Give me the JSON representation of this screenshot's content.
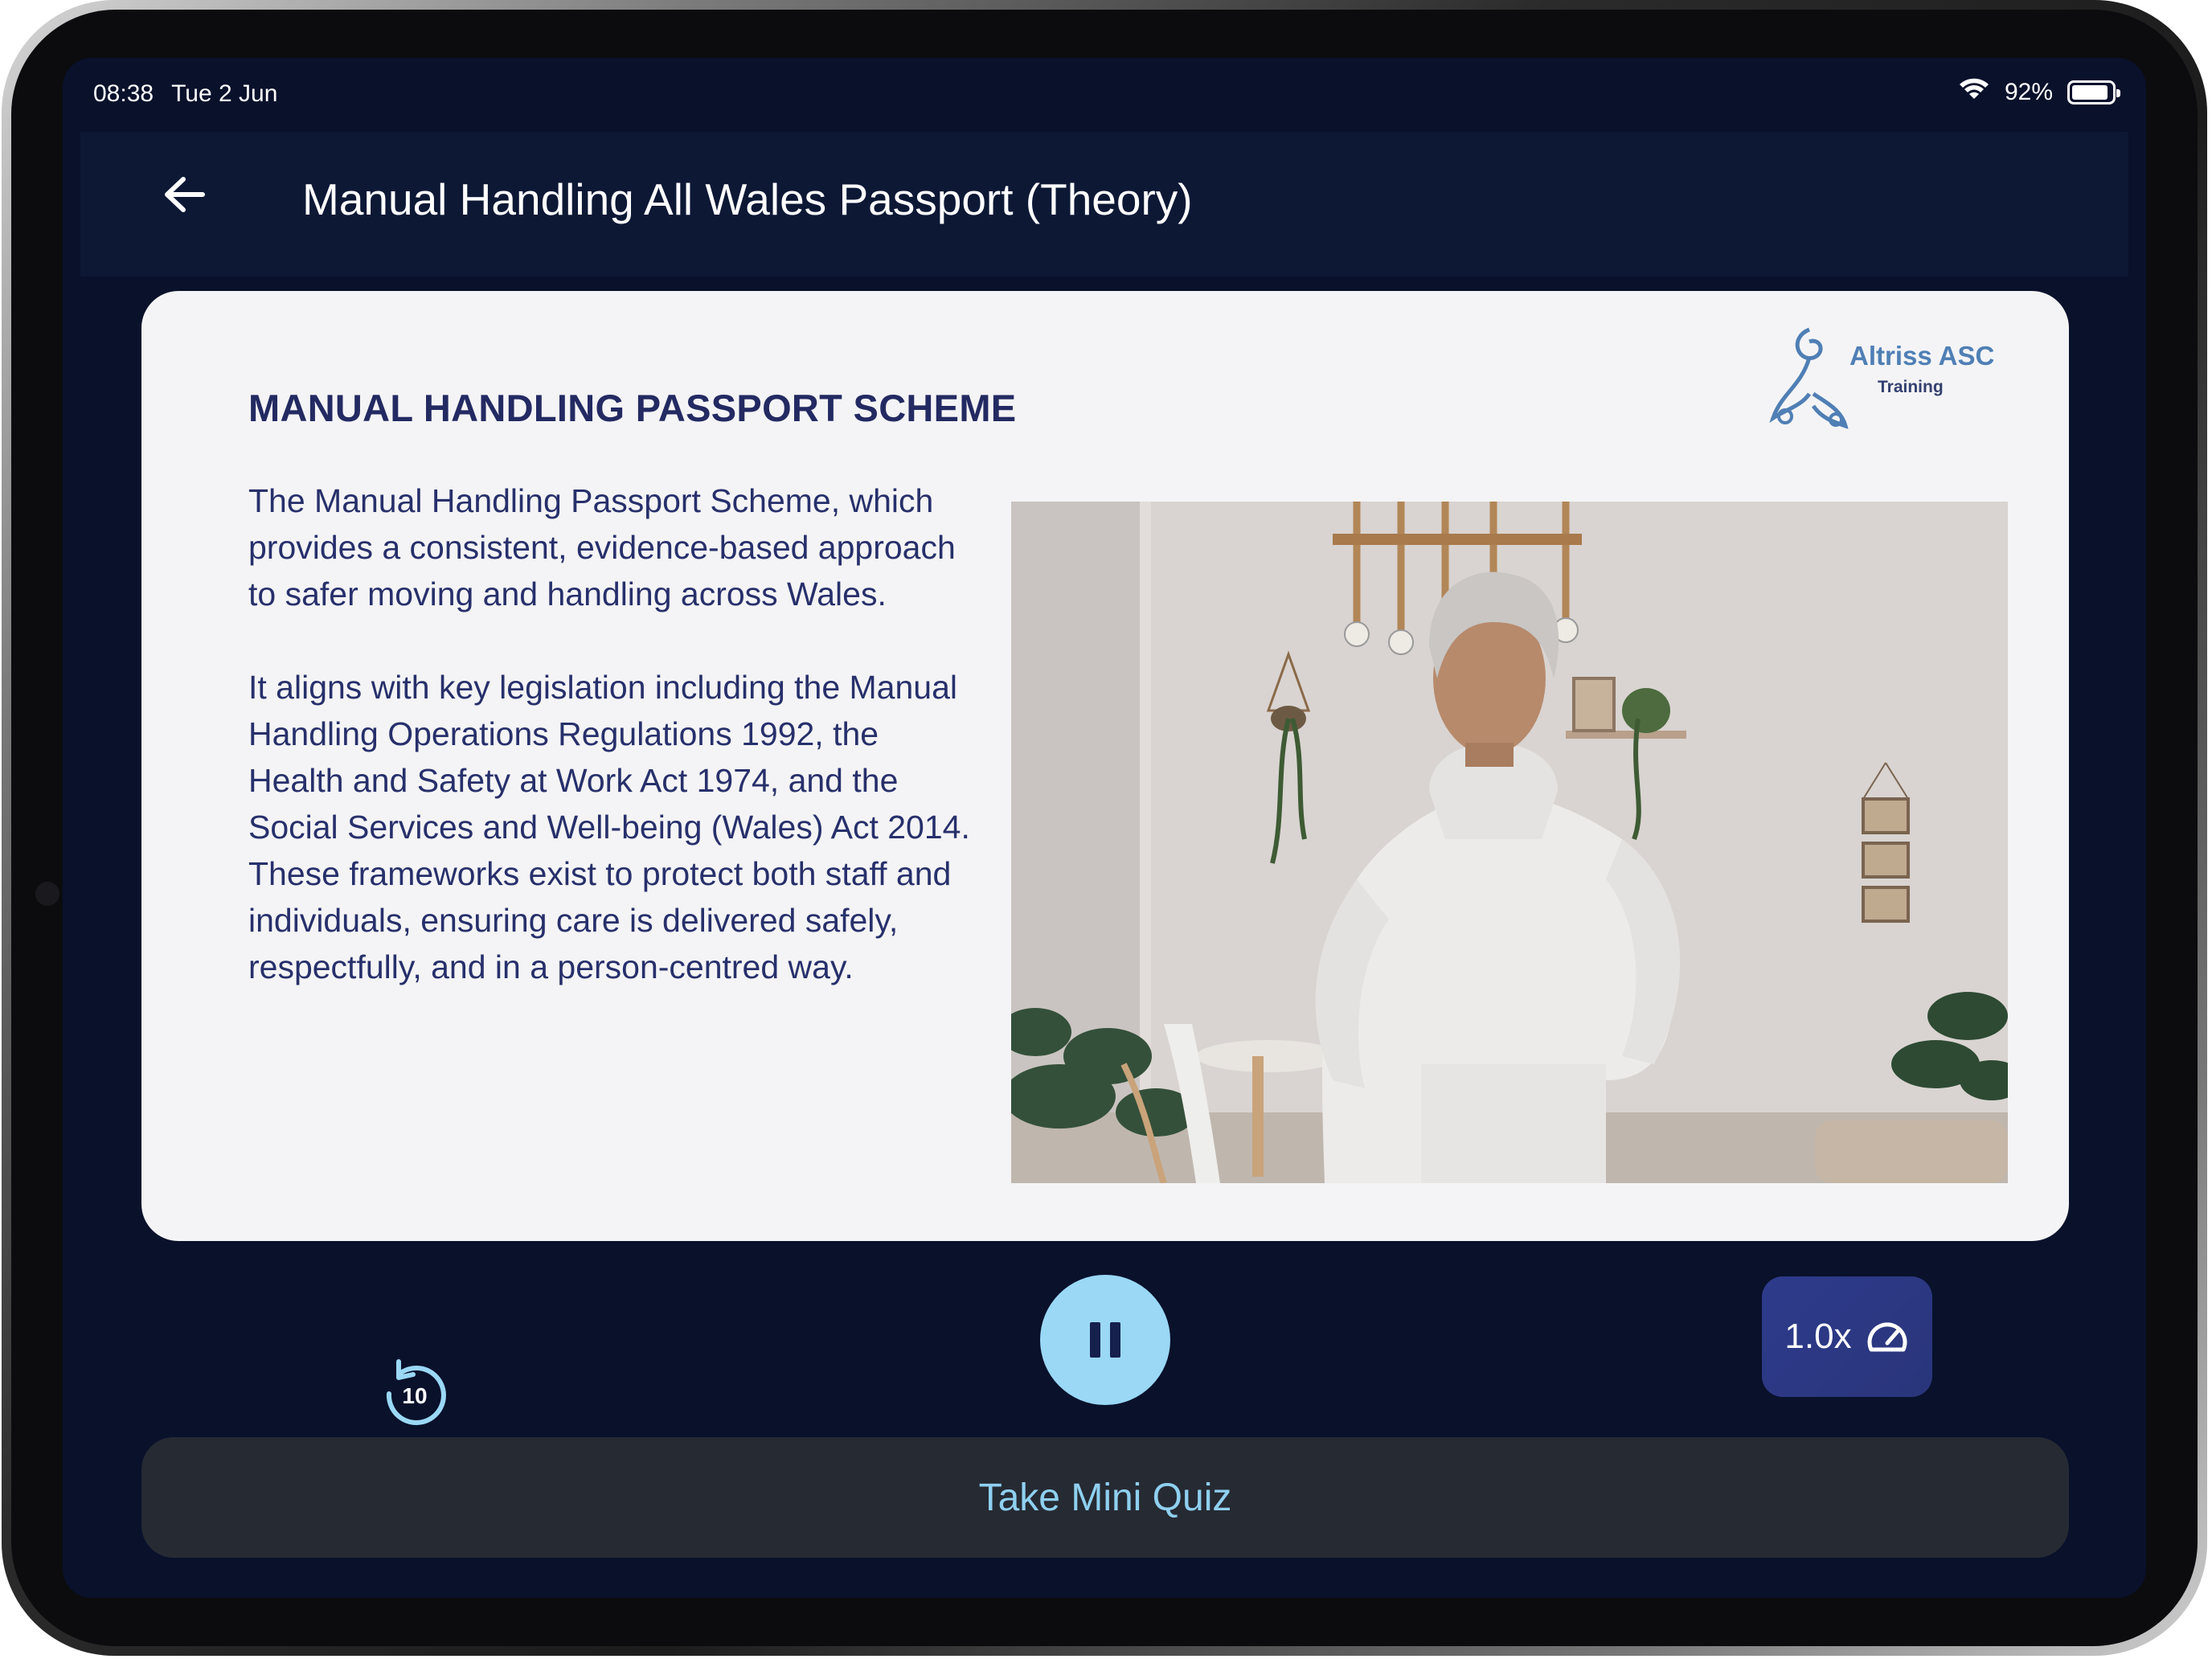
{
  "status_bar": {
    "time": "08:38",
    "date": "Tue 2 Jun",
    "battery_percent": "92%",
    "battery_level": 0.92
  },
  "header": {
    "back_icon": "arrow-left-icon",
    "title": "Manual Handling All Wales Passport (Theory)"
  },
  "slide": {
    "heading": "MANUAL HANDLING PASSPORT SCHEME",
    "paragraphs": [
      "The Manual Handling Passport Scheme, which provides a consistent, evidence-based approach to safer moving and handling across Wales.",
      "It aligns with key legislation including the Manual Handling Operations Regulations 1992, the Health and Safety at Work Act 1974, and the Social Services and Well-being (Wales) Act 2014. These frameworks exist to protect both staff and individuals, ensuring care is delivered safely, respectfully, and in a person-centred way."
    ],
    "logo": {
      "name": "Altriss ASC",
      "subtitle": "Training"
    }
  },
  "controls": {
    "rewind_icon": "rewind-10-icon",
    "rewind_seconds": "10",
    "play_state_icon": "pause-icon",
    "speed_label": "1.0x",
    "speed_icon": "speedometer-icon"
  },
  "quiz_button": {
    "label": "Take Mini Quiz"
  },
  "colors": {
    "screen_bg": "#09112b",
    "header_bg": "#0d1835",
    "slide_text": "#27306b",
    "play_button": "#9ad8f6",
    "speed_button": "#2d3b8c",
    "quiz_text": "#8fd0f0"
  }
}
